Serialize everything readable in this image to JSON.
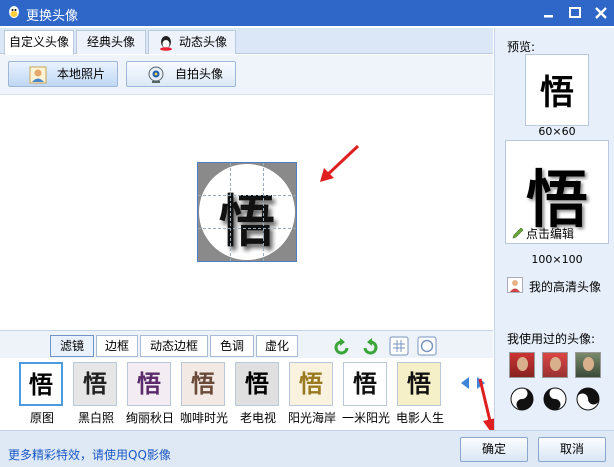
{
  "window": {
    "title": "更换头像"
  },
  "tabs": [
    "自定义头像",
    "经典头像",
    "动态头像"
  ],
  "toolbar": {
    "local_photo": "本地照片",
    "selfie": "自拍头像"
  },
  "crop": {
    "glyph": "悟"
  },
  "filter_tabs": [
    "滤镜",
    "边框",
    "动态边框",
    "色调",
    "虚化"
  ],
  "filters": [
    {
      "name": "原图",
      "bg": "#ffffff",
      "fg": "#000000"
    },
    {
      "name": "黑白照",
      "bg": "#e6e6e6",
      "fg": "#222222"
    },
    {
      "name": "绚丽秋日",
      "bg": "#f3ecf3",
      "fg": "#5a2a6a"
    },
    {
      "name": "咖啡时光",
      "bg": "#f2e9e4",
      "fg": "#6b4a3a"
    },
    {
      "name": "老电视",
      "bg": "#e0e0e0",
      "fg": "#000000"
    },
    {
      "name": "阳光海岸",
      "bg": "#f9f2df",
      "fg": "#9a7a20"
    },
    {
      "name": "一米阳光",
      "bg": "#ffffff",
      "fg": "#111111"
    },
    {
      "name": "电影人生",
      "bg": "#f5f0c8",
      "fg": "#111111"
    }
  ],
  "preview": {
    "title": "预览:",
    "glyph": "悟",
    "size_small": "60×60",
    "size_large": "100×100",
    "edit_label": "点击编辑",
    "hd_label": "我的高清头像",
    "used_title": "我使用过的头像:"
  },
  "bottom": {
    "more_link": "更多精彩特效，请使用QQ影像",
    "ok": "确定",
    "cancel": "取消"
  },
  "colors": {
    "titlebar": "#2f67c9",
    "accent": "#4a9be0",
    "arrow": "#e02020"
  }
}
